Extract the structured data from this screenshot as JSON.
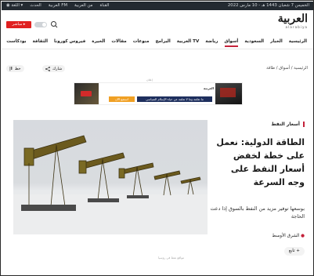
{
  "utilbar": {
    "date": "الخميس 7 شعبان 1443 هـ - 10 مارس 2022",
    "nav": [
      "العربية FM",
      "الحدث",
      "اللغة"
    ],
    "nav_extra": [
      "القناة",
      "من العربية"
    ]
  },
  "header": {
    "logo_ar": "العربية",
    "logo_en": "alarabiya",
    "live_label": "مباشر",
    "toggle_label": "",
    "search_icon": "search-icon"
  },
  "mainnav": {
    "items": [
      "الرئيسية",
      "الخبار",
      "السعودية",
      "أسواق",
      "رياضة",
      "العربية TV",
      "البرامج",
      "منوعات",
      "مقالات",
      "الخيرة",
      "فيروس كورونا",
      "الثقافة",
      "بودكاست"
    ],
    "active_index": 3
  },
  "crumbs": {
    "text": "الرئيسية / أسواق / طاقة"
  },
  "actions": {
    "share_label": "شارك",
    "font_label": "خط"
  },
  "ad": {
    "label": "إعلان",
    "cta": "استمع الآن",
    "message": "ما تعلمه وما لا تعلمه عن حياة الإسلام السياسي",
    "brand": "العربية"
  },
  "article": {
    "tag": "أسعار النفط",
    "headline": "الطاقة الدولية: نعمل على خطة لخفض أسعار النفط على وجه السرعة",
    "subhead": "بوسعها توفير مزيد من النفط بالسوق إذا دعت الحاجة",
    "source": "الشرق الأوسط",
    "follow": "تابع",
    "caption": "مواقع نفط في روسيا"
  },
  "colors": {
    "accent": "#c4223a",
    "live": "#e02020",
    "topbar": "#232a31"
  }
}
